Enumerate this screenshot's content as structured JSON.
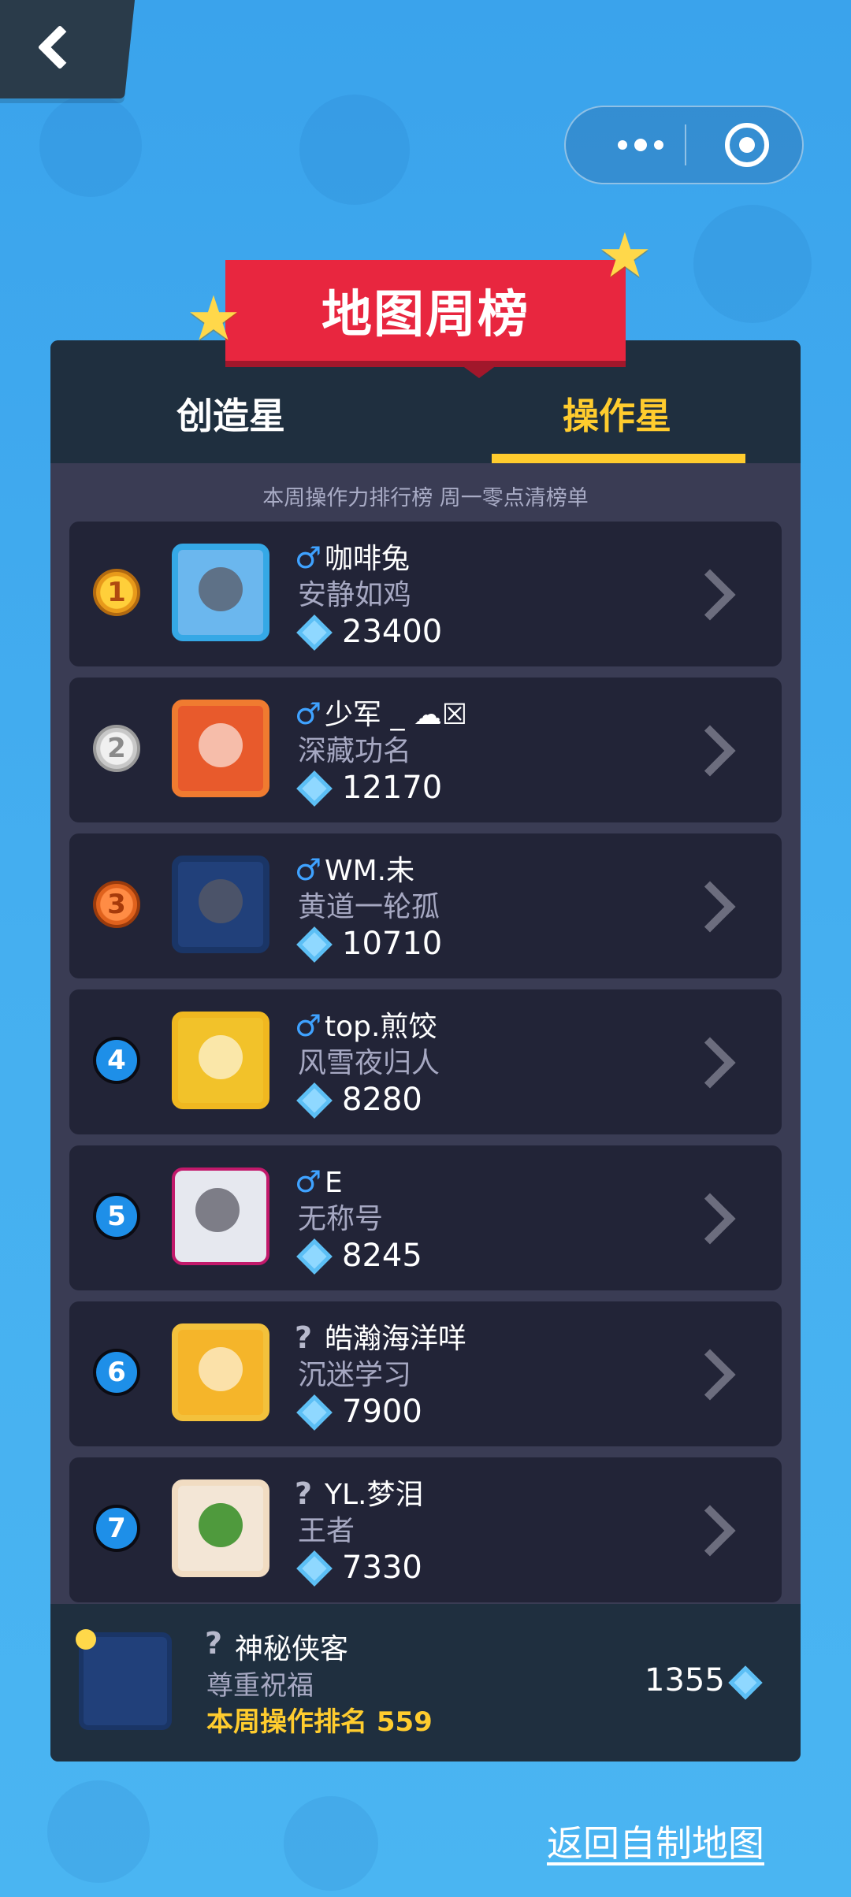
{
  "header": {
    "title": "地图周榜"
  },
  "tabs": [
    {
      "label": "创造星",
      "active": false
    },
    {
      "label": "操作星",
      "active": true
    }
  ],
  "subtitle": "本周操作力排行榜 周一零点清榜单",
  "rankings": [
    {
      "rank": "1",
      "gender": "♂",
      "name": "咖啡兔",
      "title": "安静如鸡",
      "score": "23400"
    },
    {
      "rank": "2",
      "gender": "♂",
      "name": "少军 _ ☁☒",
      "title": "深藏功名",
      "score": "12170"
    },
    {
      "rank": "3",
      "gender": "♂",
      "name": "WM.未",
      "title": "黄道一轮孤",
      "score": "10710"
    },
    {
      "rank": "4",
      "gender": "♂",
      "name": "top.煎饺",
      "title": "风雪夜归人",
      "score": "8280"
    },
    {
      "rank": "5",
      "gender": "♂",
      "name": "E",
      "title": "无称号",
      "score": "8245"
    },
    {
      "rank": "6",
      "gender": "?",
      "name": "皓瀚海洋咩",
      "title": "沉迷学习",
      "score": "7900"
    },
    {
      "rank": "7",
      "gender": "?",
      "name": "YL.梦泪",
      "title": "王者",
      "score": "7330"
    }
  ],
  "me": {
    "gender": "?",
    "name": "神秘侠客",
    "title": "尊重祝福",
    "rank_text": "本周操作排名 559",
    "score": "1355"
  },
  "footer": {
    "return_label": "返回自制地图"
  },
  "colors": {
    "accent": "#ffcc2e",
    "ribbon": "#e8263f",
    "panel": "#3a3c54",
    "row": "#222437",
    "background": "#3fa9ee"
  }
}
